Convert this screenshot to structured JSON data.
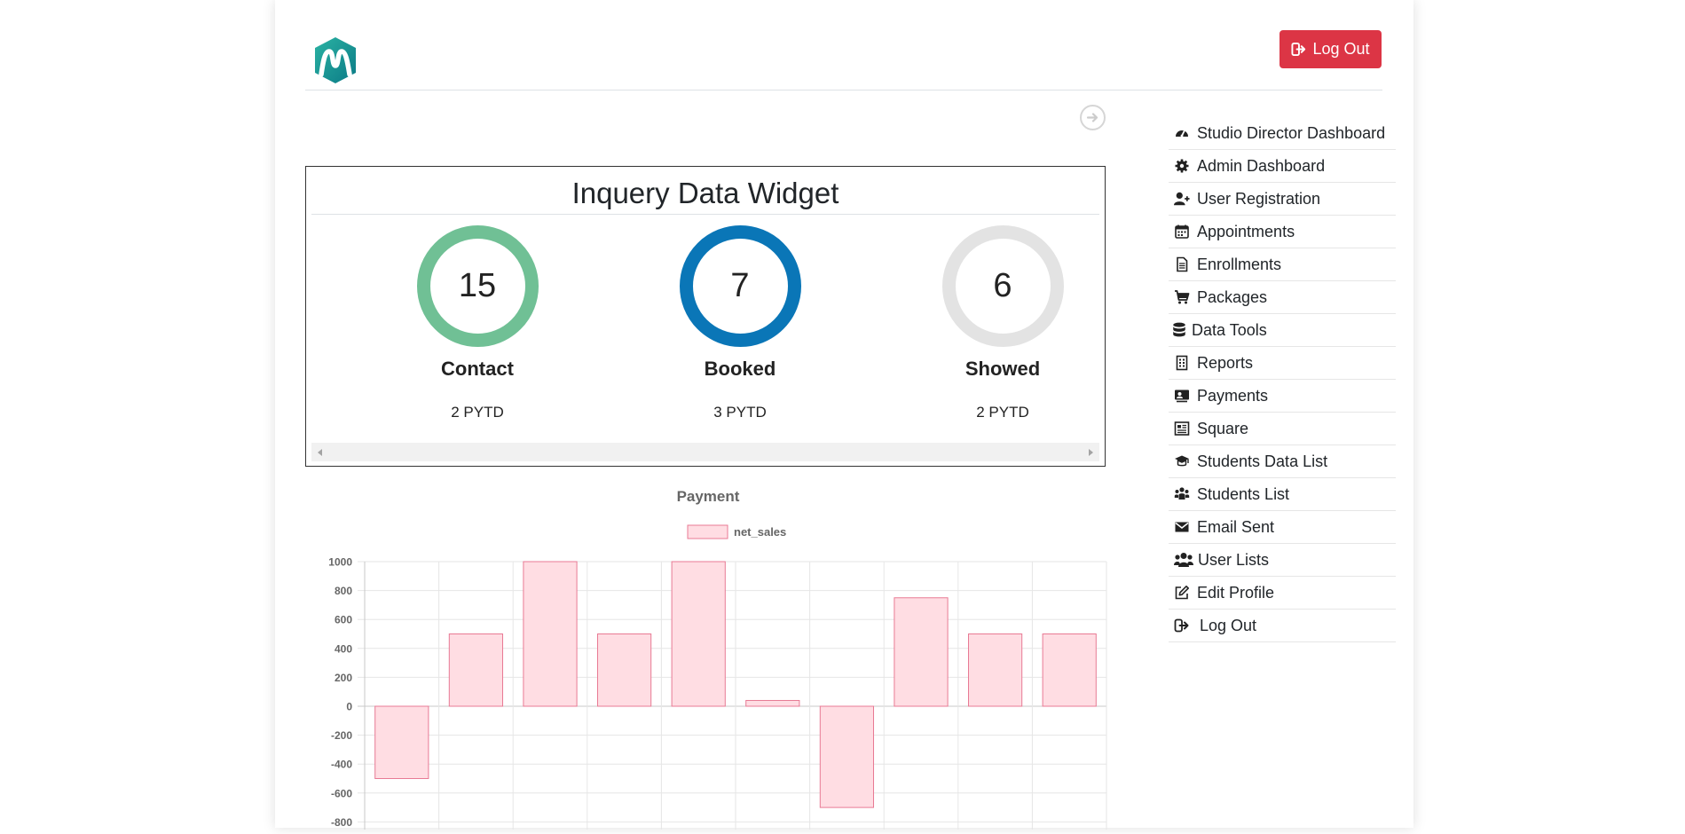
{
  "header": {
    "logout_label": "Log Out"
  },
  "widget": {
    "title": "Inquery Data Widget",
    "stats": [
      {
        "value": "15",
        "label": "Contact",
        "sub": "2 PYTD",
        "ring_color": "#70c095"
      },
      {
        "value": "7",
        "label": "Booked",
        "sub": "3 PYTD",
        "ring_color": "#0a76b7"
      },
      {
        "value": "6",
        "label": "Showed",
        "sub": "2 PYTD",
        "ring_color": "#e3e3e3"
      }
    ]
  },
  "sidebar": {
    "items": [
      {
        "label": "Studio Director Dashboard",
        "icon": "dashboard-gauge-icon"
      },
      {
        "label": "Admin Dashboard",
        "icon": "gear-icon"
      },
      {
        "label": "User Registration",
        "icon": "user-plus-icon"
      },
      {
        "label": "Appointments",
        "icon": "calendar-icon"
      },
      {
        "label": "Enrollments",
        "icon": "document-icon"
      },
      {
        "label": "Packages",
        "icon": "cart-icon"
      },
      {
        "label": "Data Tools",
        "icon": "database-icon"
      },
      {
        "label": "Reports",
        "icon": "report-icon"
      },
      {
        "label": "Payments",
        "icon": "payment-icon"
      },
      {
        "label": "Square",
        "icon": "square-card-icon"
      },
      {
        "label": "Students Data List",
        "icon": "graduation-cap-icon"
      },
      {
        "label": "Students List",
        "icon": "people-icon"
      },
      {
        "label": "Email Sent",
        "icon": "envelope-icon"
      },
      {
        "label": "User Lists",
        "icon": "users-icon"
      },
      {
        "label": "Edit Profile",
        "icon": "edit-icon"
      },
      {
        "label": "Log Out",
        "icon": "logout-icon"
      }
    ]
  },
  "chart_data": {
    "type": "bar",
    "title": "Payment",
    "categories": [
      "",
      "",
      "",
      "",
      "",
      "",
      "",
      "",
      "",
      ""
    ],
    "series": [
      {
        "name": "net_sales",
        "values": [
          -500,
          500,
          1000,
          500,
          1000,
          40,
          -700,
          750,
          500,
          500
        ]
      }
    ],
    "ylim": [
      -1000,
      1000
    ],
    "yticks": [
      1000,
      800,
      600,
      400,
      200,
      0,
      -200,
      -400,
      -600,
      -800
    ],
    "grid": true,
    "legend": "top",
    "colors": {
      "fill": "#ffdde3",
      "border": "#e87a94"
    }
  }
}
